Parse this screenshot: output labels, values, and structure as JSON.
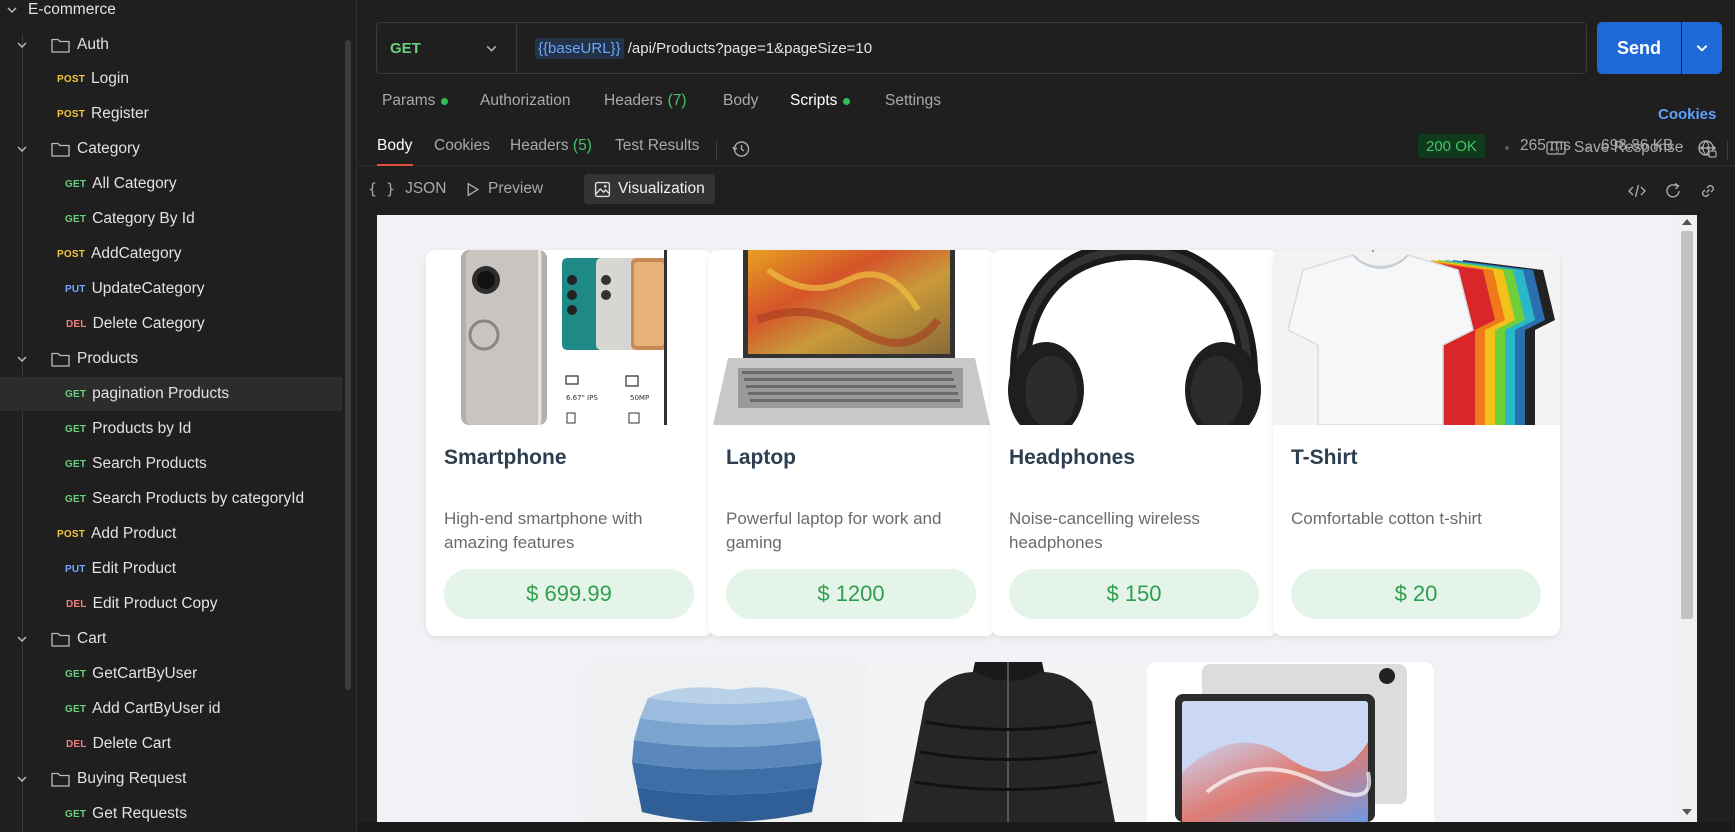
{
  "sidebar": {
    "collection": "E-commerce",
    "folders": {
      "auth": "Auth",
      "category": "Category",
      "products": "Products",
      "cart": "Cart",
      "buying": "Buying Request"
    },
    "requests": [
      {
        "method": "POST",
        "name": "Login"
      },
      {
        "method": "POST",
        "name": "Register"
      },
      {
        "method": "GET",
        "name": "All Category"
      },
      {
        "method": "GET",
        "name": "Category By Id"
      },
      {
        "method": "POST",
        "name": "AddCategory"
      },
      {
        "method": "PUT",
        "name": "UpdateCategory"
      },
      {
        "method": "DEL",
        "name": "Delete Category"
      },
      {
        "method": "GET",
        "name": "pagination Products"
      },
      {
        "method": "GET",
        "name": "Products by Id"
      },
      {
        "method": "GET",
        "name": "Search Products"
      },
      {
        "method": "GET",
        "name": "Search Products by categoryId"
      },
      {
        "method": "POST",
        "name": "Add Product"
      },
      {
        "method": "PUT",
        "name": "Edit Product"
      },
      {
        "method": "DEL",
        "name": "Edit Product Copy"
      },
      {
        "method": "GET",
        "name": "GetCartByUser"
      },
      {
        "method": "GET",
        "name": "Add CartByUser id"
      },
      {
        "method": "DEL",
        "name": "Delete Cart"
      },
      {
        "method": "GET",
        "name": "Get Requests"
      }
    ]
  },
  "request": {
    "method": "GET",
    "url_variable": "{{baseURL}}",
    "url_path": " /api/Products?page=1&pageSize=10",
    "send_label": "Send"
  },
  "request_tabs": {
    "params": "Params",
    "authorization": "Authorization",
    "headers": "Headers",
    "headers_count": "(7)",
    "body": "Body",
    "scripts": "Scripts",
    "settings": "Settings",
    "cookies_link": "Cookies"
  },
  "response_tabs": {
    "body": "Body",
    "cookies": "Cookies",
    "headers": "Headers",
    "headers_count": "(5)",
    "test_results": "Test Results"
  },
  "response_meta": {
    "status": "200 OK",
    "time": "265 ms",
    "size": "698.86 KB",
    "save_response": "Save Response"
  },
  "view_tabs": {
    "json": "JSON",
    "preview": "Preview",
    "visualization": "Visualization"
  },
  "products": [
    {
      "name": "Smartphone",
      "description": "High-end smartphone with amazing features",
      "price": "$ 699.99"
    },
    {
      "name": "Laptop",
      "description": "Powerful laptop for work and gaming",
      "price": "$ 1200"
    },
    {
      "name": "Headphones",
      "description": "Noise-cancelling wireless headphones",
      "price": "$ 150"
    },
    {
      "name": "T-Shirt",
      "description": "Comfortable cotton t-shirt",
      "price": "$ 20"
    }
  ],
  "phone_spec_labels": {
    "display": "6.67\" IPS",
    "camera": "50MP"
  },
  "colors": {
    "accent_blue": "#1e68d8",
    "get_green": "#6bcf7f",
    "post_yellow": "#f5c542",
    "put_blue": "#74a8ff",
    "del_red": "#f08080",
    "price_green": "#2f9e4e",
    "active_tab_underline": "#e0533a"
  }
}
